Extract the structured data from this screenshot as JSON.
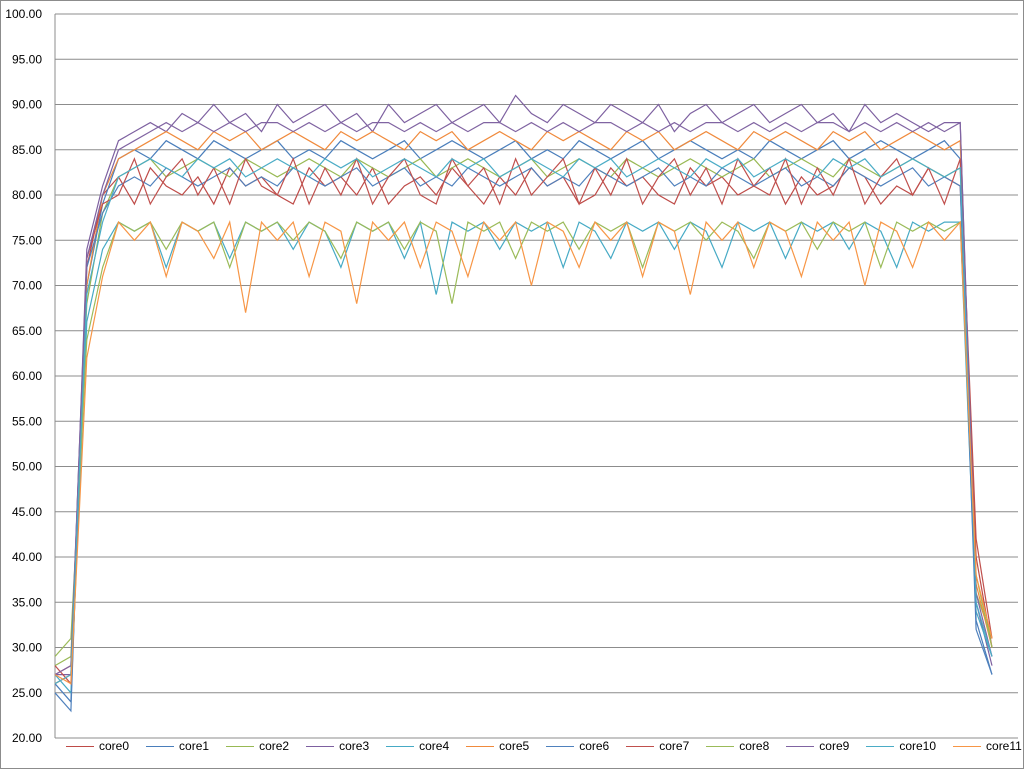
{
  "chart_data": {
    "type": "line",
    "title": "",
    "xlabel": "",
    "ylabel": "",
    "ylim": [
      20,
      100
    ],
    "yticks": [
      "20.00",
      "25.00",
      "30.00",
      "35.00",
      "40.00",
      "45.00",
      "50.00",
      "55.00",
      "60.00",
      "65.00",
      "70.00",
      "75.00",
      "80.00",
      "85.00",
      "90.00",
      "95.00",
      "100.00"
    ],
    "grid": true,
    "legend_position": "bottom",
    "series": [
      {
        "name": "core0",
        "color": "#be4b48",
        "values": [
          27,
          28,
          72,
          80,
          82,
          79,
          83,
          81,
          80,
          82,
          79,
          83,
          81,
          82,
          80,
          79,
          83,
          81,
          82,
          80,
          83,
          79,
          81,
          82,
          80,
          83,
          81,
          79,
          82,
          80,
          83,
          81,
          82,
          79,
          80,
          83,
          81,
          82,
          80,
          79,
          83,
          81,
          82,
          80,
          81,
          83,
          79,
          82,
          80,
          81,
          83,
          82,
          79,
          81,
          80,
          83,
          82,
          81,
          40,
          30
        ]
      },
      {
        "name": "core1",
        "color": "#4a7ebb",
        "values": [
          26,
          24,
          70,
          79,
          84,
          85,
          84,
          86,
          85,
          84,
          86,
          85,
          84,
          85,
          86,
          84,
          85,
          84,
          86,
          85,
          84,
          85,
          86,
          84,
          85,
          86,
          85,
          84,
          85,
          86,
          84,
          85,
          84,
          86,
          85,
          84,
          85,
          86,
          84,
          85,
          86,
          85,
          84,
          85,
          84,
          86,
          85,
          84,
          85,
          86,
          84,
          85,
          86,
          85,
          84,
          85,
          86,
          84,
          33,
          27
        ]
      },
      {
        "name": "core2",
        "color": "#98b954",
        "values": [
          28,
          29,
          68,
          78,
          82,
          83,
          84,
          82,
          83,
          84,
          83,
          82,
          84,
          83,
          82,
          83,
          84,
          83,
          82,
          84,
          83,
          82,
          83,
          84,
          82,
          83,
          84,
          83,
          82,
          83,
          84,
          82,
          83,
          84,
          83,
          82,
          84,
          83,
          82,
          83,
          84,
          83,
          82,
          83,
          84,
          82,
          83,
          84,
          83,
          82,
          84,
          83,
          82,
          83,
          84,
          83,
          82,
          83,
          36,
          31
        ]
      },
      {
        "name": "core3",
        "color": "#7d60a0",
        "values": [
          27,
          27,
          74,
          81,
          86,
          87,
          88,
          87,
          89,
          88,
          90,
          88,
          89,
          87,
          90,
          88,
          89,
          90,
          88,
          89,
          87,
          90,
          88,
          89,
          90,
          88,
          89,
          90,
          88,
          91,
          89,
          88,
          90,
          89,
          88,
          90,
          89,
          88,
          90,
          87,
          89,
          90,
          88,
          89,
          90,
          88,
          89,
          90,
          88,
          89,
          87,
          90,
          88,
          89,
          88,
          87,
          88,
          88,
          35,
          28
        ]
      },
      {
        "name": "core4",
        "color": "#46aac5",
        "values": [
          27,
          25,
          66,
          74,
          77,
          76,
          77,
          72,
          77,
          76,
          77,
          73,
          77,
          76,
          77,
          74,
          77,
          76,
          72,
          77,
          76,
          77,
          73,
          77,
          69,
          77,
          76,
          77,
          74,
          77,
          76,
          77,
          72,
          77,
          76,
          73,
          77,
          76,
          77,
          74,
          77,
          76,
          72,
          77,
          76,
          77,
          73,
          77,
          76,
          77,
          74,
          77,
          76,
          72,
          77,
          76,
          77,
          77,
          34,
          29
        ]
      },
      {
        "name": "core5",
        "color": "#f08a3c",
        "values": [
          26,
          27,
          70,
          80,
          84,
          85,
          86,
          87,
          86,
          85,
          87,
          86,
          87,
          85,
          86,
          87,
          86,
          85,
          87,
          86,
          87,
          86,
          85,
          87,
          86,
          87,
          85,
          86,
          87,
          86,
          85,
          87,
          86,
          87,
          86,
          85,
          87,
          86,
          87,
          85,
          86,
          87,
          86,
          85,
          87,
          86,
          87,
          86,
          85,
          87,
          86,
          87,
          85,
          86,
          87,
          86,
          85,
          86,
          37,
          30
        ]
      },
      {
        "name": "core6",
        "color": "#4f81bd",
        "values": [
          25,
          23,
          72,
          78,
          81,
          82,
          81,
          83,
          82,
          81,
          82,
          83,
          81,
          82,
          81,
          83,
          82,
          81,
          82,
          83,
          81,
          82,
          83,
          81,
          82,
          81,
          83,
          82,
          81,
          82,
          83,
          81,
          82,
          81,
          83,
          82,
          81,
          82,
          83,
          81,
          82,
          81,
          83,
          82,
          81,
          82,
          83,
          81,
          82,
          81,
          83,
          82,
          81,
          82,
          83,
          81,
          82,
          81,
          32,
          27
        ]
      },
      {
        "name": "core7",
        "color": "#c0504d",
        "values": [
          28,
          26,
          73,
          79,
          80,
          84,
          79,
          82,
          84,
          80,
          83,
          79,
          84,
          81,
          80,
          84,
          79,
          83,
          80,
          84,
          79,
          82,
          84,
          80,
          79,
          84,
          81,
          83,
          79,
          84,
          80,
          82,
          84,
          79,
          83,
          80,
          84,
          79,
          82,
          84,
          80,
          83,
          79,
          84,
          81,
          80,
          84,
          79,
          83,
          80,
          84,
          79,
          82,
          84,
          80,
          83,
          79,
          84,
          42,
          31
        ]
      },
      {
        "name": "core8",
        "color": "#9bbb59",
        "values": [
          29,
          31,
          64,
          72,
          77,
          76,
          77,
          74,
          77,
          76,
          77,
          72,
          77,
          76,
          77,
          75,
          77,
          76,
          73,
          77,
          76,
          77,
          74,
          77,
          76,
          68,
          77,
          76,
          77,
          73,
          77,
          76,
          77,
          74,
          77,
          76,
          77,
          72,
          77,
          76,
          77,
          75,
          77,
          76,
          73,
          77,
          76,
          77,
          74,
          77,
          76,
          77,
          72,
          77,
          76,
          77,
          76,
          77,
          38,
          30
        ]
      },
      {
        "name": "core9",
        "color": "#8064a2",
        "values": [
          27,
          28,
          73,
          80,
          85,
          86,
          87,
          88,
          87,
          88,
          87,
          88,
          87,
          88,
          88,
          87,
          88,
          87,
          88,
          87,
          88,
          88,
          87,
          88,
          87,
          88,
          87,
          88,
          88,
          87,
          88,
          87,
          88,
          87,
          88,
          88,
          87,
          88,
          87,
          88,
          87,
          88,
          88,
          87,
          88,
          87,
          88,
          87,
          88,
          88,
          87,
          88,
          87,
          88,
          87,
          88,
          87,
          88,
          36,
          29
        ]
      },
      {
        "name": "core10",
        "color": "#4bacc6",
        "values": [
          26,
          27,
          69,
          77,
          82,
          83,
          84,
          83,
          82,
          84,
          83,
          84,
          82,
          83,
          84,
          83,
          82,
          84,
          83,
          84,
          82,
          83,
          84,
          83,
          82,
          84,
          83,
          84,
          82,
          83,
          84,
          83,
          82,
          84,
          83,
          84,
          82,
          83,
          84,
          83,
          82,
          84,
          83,
          84,
          82,
          83,
          84,
          83,
          82,
          84,
          83,
          84,
          82,
          83,
          84,
          83,
          82,
          83,
          35,
          29
        ]
      },
      {
        "name": "core11",
        "color": "#f79646",
        "values": [
          27,
          26,
          62,
          71,
          77,
          75,
          77,
          71,
          77,
          76,
          73,
          77,
          67,
          77,
          75,
          77,
          71,
          77,
          76,
          68,
          77,
          75,
          77,
          72,
          77,
          76,
          71,
          77,
          75,
          77,
          70,
          77,
          76,
          72,
          77,
          75,
          77,
          71,
          77,
          76,
          69,
          77,
          75,
          77,
          72,
          77,
          76,
          71,
          77,
          75,
          77,
          70,
          77,
          76,
          72,
          77,
          75,
          77,
          38,
          31
        ]
      }
    ]
  }
}
